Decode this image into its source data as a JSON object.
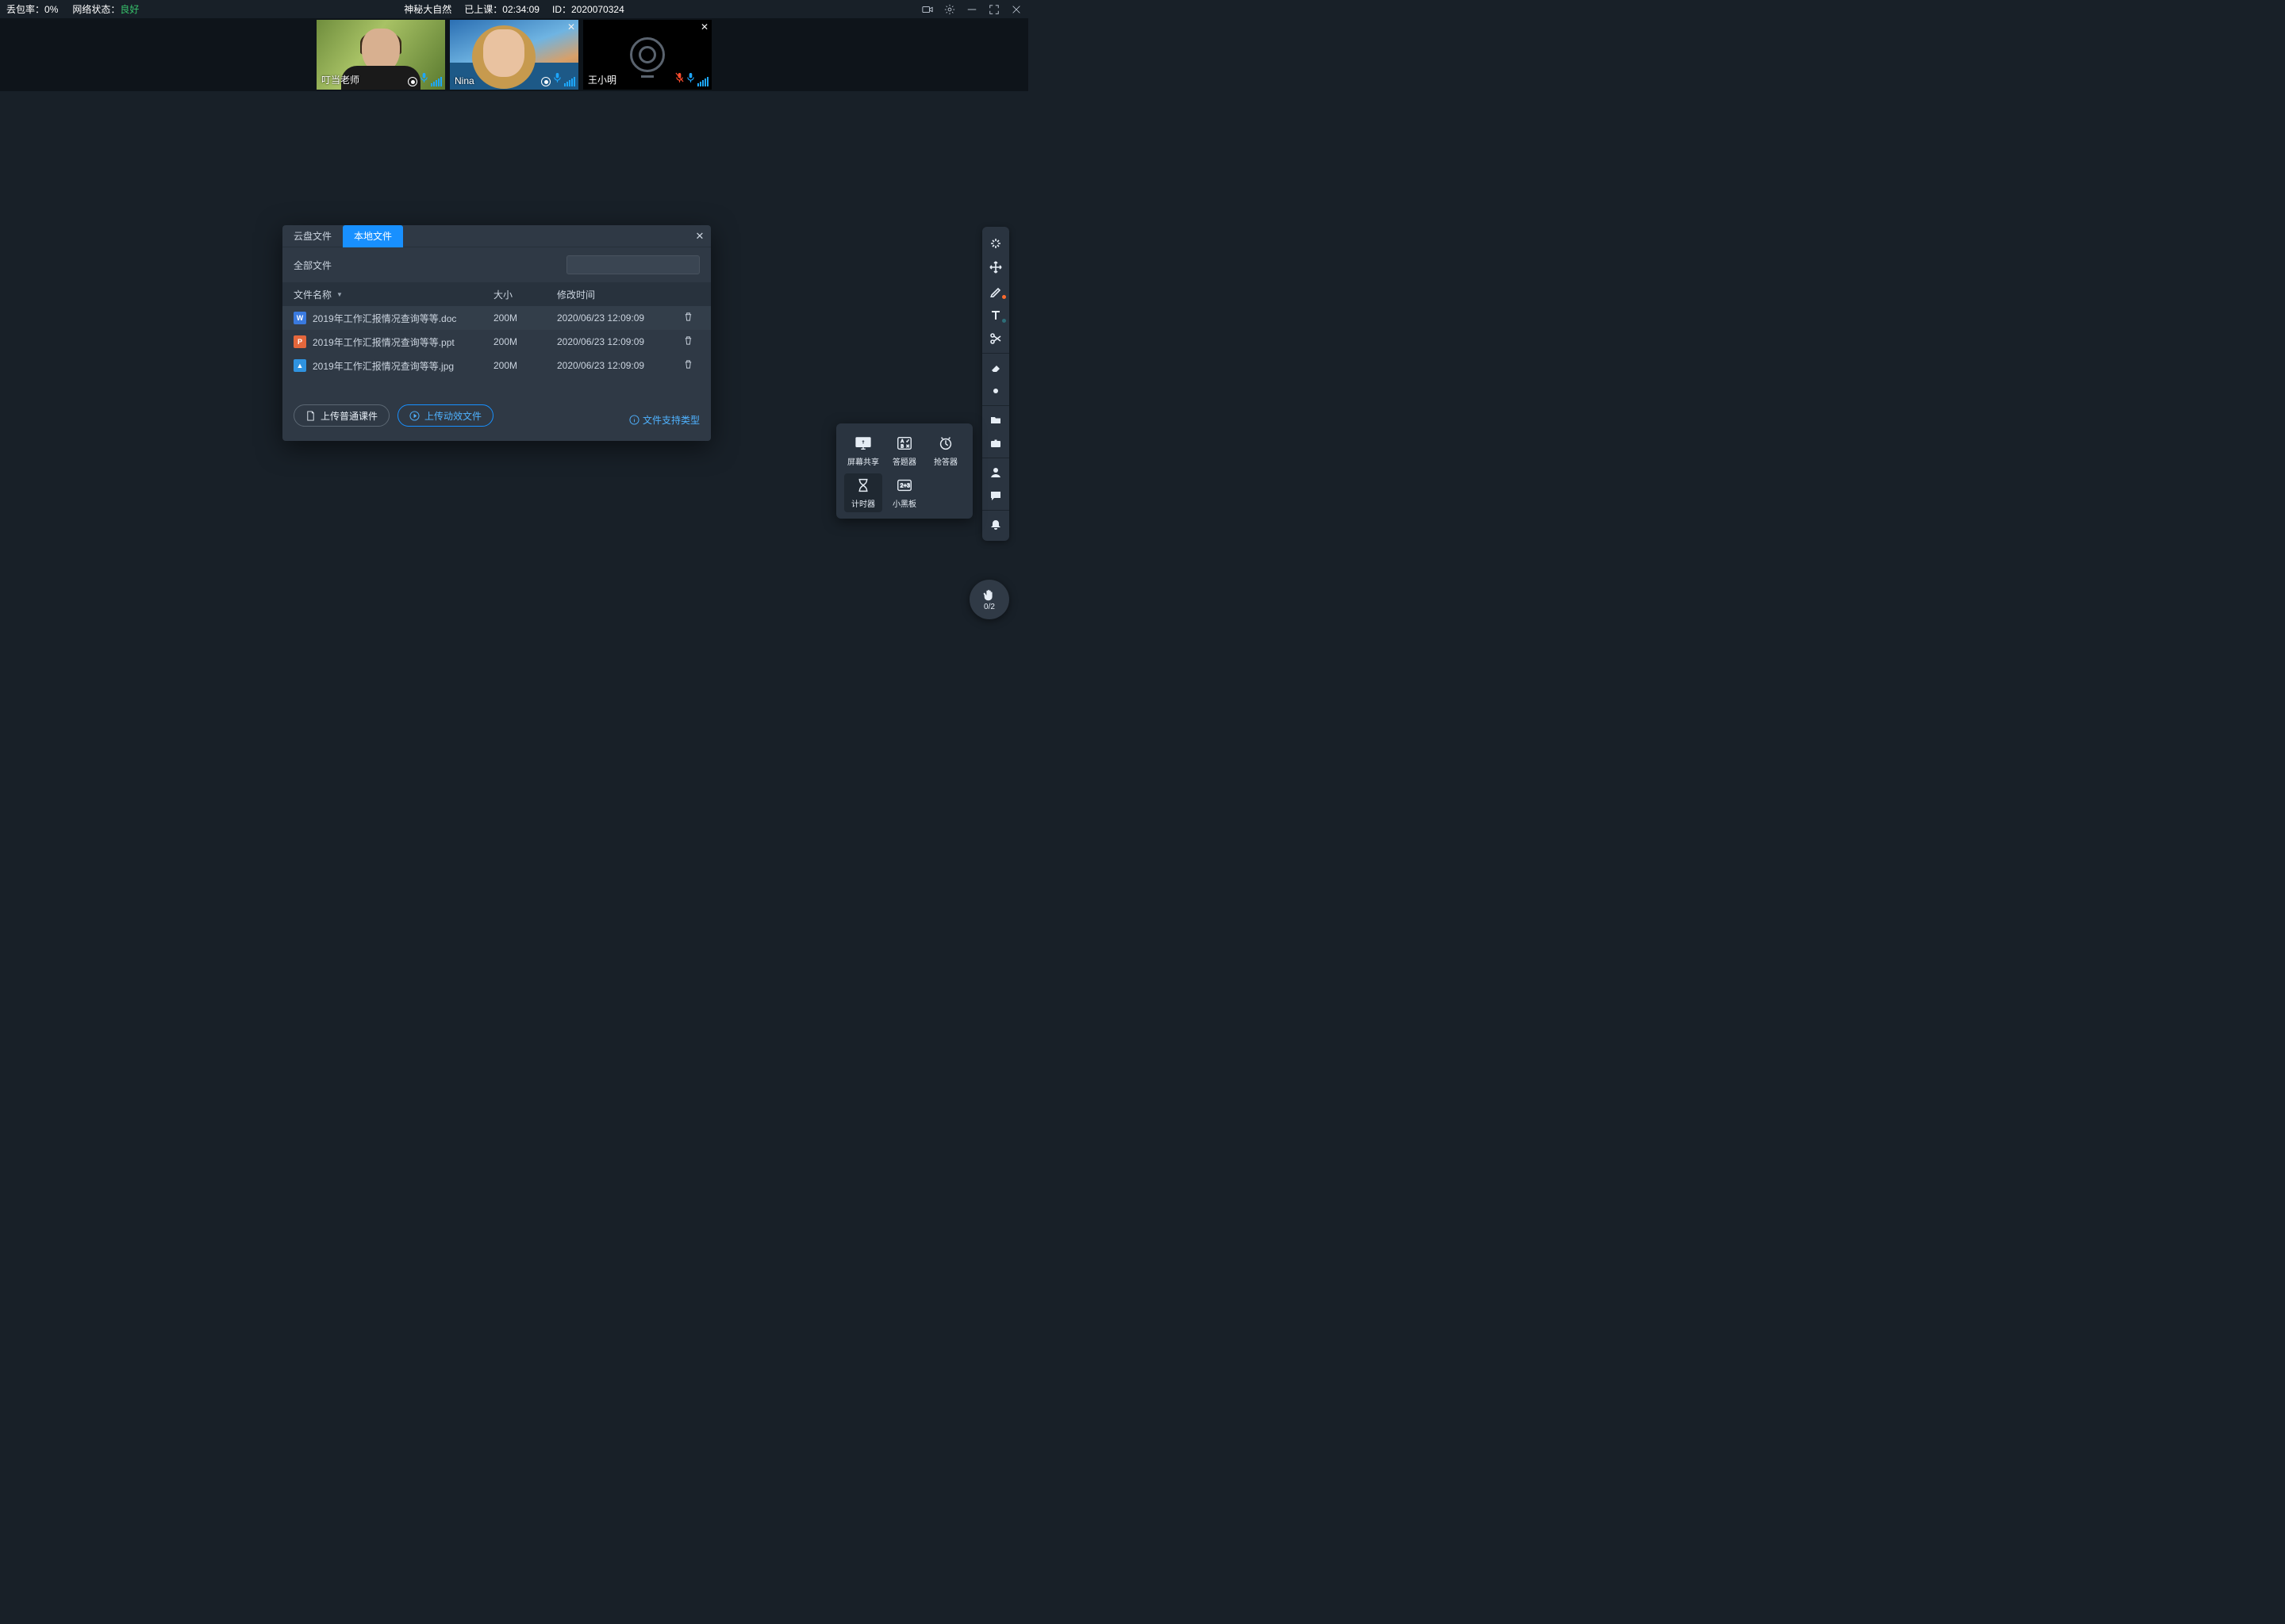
{
  "topbar": {
    "packet_loss_label": "丢包率：",
    "packet_loss_value": "0%",
    "net_label": "网络状态：",
    "net_value": "良好",
    "title": "神秘大自然",
    "elapsed_label": "已上课：",
    "elapsed_value": "02:34:09",
    "id_label": "ID：",
    "id_value": "2020070324"
  },
  "participants": [
    {
      "name": "叮当老师"
    },
    {
      "name": "Nina"
    },
    {
      "name": "王小明"
    }
  ],
  "modal": {
    "tab_cloud": "云盘文件",
    "tab_local": "本地文件",
    "toolbar_label": "全部文件",
    "search_placeholder": "",
    "cols": {
      "name": "文件名称",
      "size": "大小",
      "time": "修改时间"
    },
    "rows": [
      {
        "icon": "W",
        "name": "2019年工作汇报情况查询等等.doc",
        "size": "200M",
        "time": "2020/06/23 12:09:09"
      },
      {
        "icon": "P",
        "name": "2019年工作汇报情况查询等等.ppt",
        "size": "200M",
        "time": "2020/06/23 12:09:09"
      },
      {
        "icon": "I",
        "name": "2019年工作汇报情况查询等等.jpg",
        "size": "200M",
        "time": "2020/06/23 12:09:09"
      }
    ],
    "btn_upload": "上传普通课件",
    "btn_upload_anim": "上传动效文件",
    "supported": "文件支持类型"
  },
  "tools_popup": {
    "screen_share": "屏幕共享",
    "answer": "答题器",
    "buzzer": "抢答器",
    "timer": "计时器",
    "blackboard": "小黑板"
  },
  "hand": {
    "count": "0/2"
  }
}
